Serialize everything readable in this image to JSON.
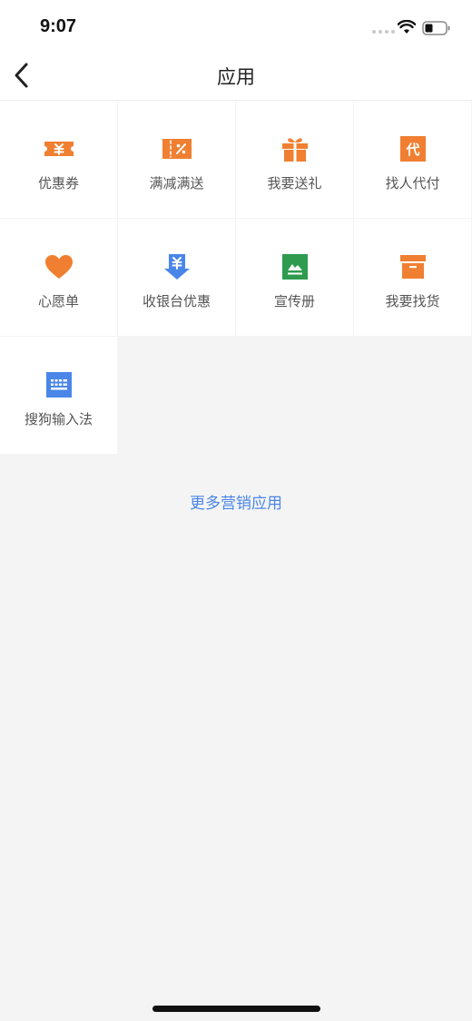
{
  "status_bar": {
    "time": "9:07"
  },
  "header": {
    "title": "应用",
    "back_icon": "chevron-left-icon"
  },
  "apps": [
    {
      "label": "优惠券",
      "icon": "coupon-icon",
      "color": "#f07f31"
    },
    {
      "label": "满减满送",
      "icon": "discount-ticket-icon",
      "color": "#f07f31"
    },
    {
      "label": "我要送礼",
      "icon": "gift-icon",
      "color": "#f07f31"
    },
    {
      "label": "找人代付",
      "icon": "pay-for-me-icon",
      "color": "#f07f31"
    },
    {
      "label": "心愿单",
      "icon": "heart-icon",
      "color": "#f07f31"
    },
    {
      "label": "收银台优惠",
      "icon": "cashier-discount-icon",
      "color": "#4a86e8"
    },
    {
      "label": "宣传册",
      "icon": "brochure-icon",
      "color": "#2e9b4f"
    },
    {
      "label": "我要找货",
      "icon": "archive-box-icon",
      "color": "#f07f31"
    },
    {
      "label": "搜狗输入法",
      "icon": "keyboard-icon",
      "color": "#4a86e8"
    }
  ],
  "footer": {
    "more_link": "更多营销应用"
  },
  "theme": {
    "accent_orange": "#f07f31",
    "link_blue": "#4a86e8",
    "green": "#2e9b4f",
    "background": "#f4f4f4"
  }
}
